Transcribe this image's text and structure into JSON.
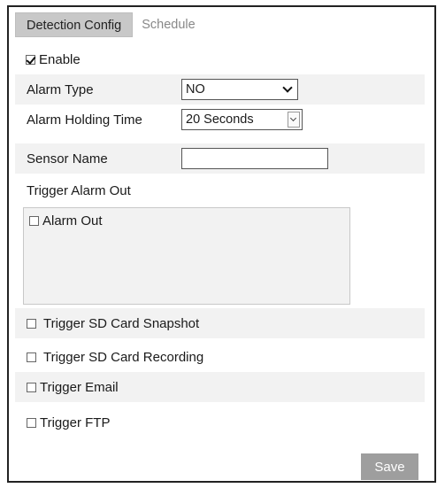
{
  "tabs": [
    {
      "label": "Detection Config",
      "active": true
    },
    {
      "label": "Schedule",
      "active": false
    }
  ],
  "enable": {
    "label": "Enable",
    "checked": true
  },
  "alarm_type": {
    "label": "Alarm Type",
    "value": "NO"
  },
  "holding_time": {
    "label": "Alarm Holding Time",
    "value": "20 Seconds"
  },
  "sensor_name": {
    "label": "Sensor Name",
    "value": ""
  },
  "trigger_alarm_out": {
    "label": "Trigger Alarm Out",
    "item_label": "Alarm Out",
    "checked": false
  },
  "triggers": [
    {
      "label": "Trigger SD Card Snapshot",
      "checked": false
    },
    {
      "label": "Trigger SD Card Recording",
      "checked": false
    },
    {
      "label": "Trigger Email",
      "checked": false
    },
    {
      "label": "Trigger FTP",
      "checked": false
    }
  ],
  "save_label": "Save",
  "colors": {
    "tab_active_bg": "#c8c8c8",
    "row_shade": "#f2f2f2",
    "save_bg": "#9e9e9e"
  }
}
